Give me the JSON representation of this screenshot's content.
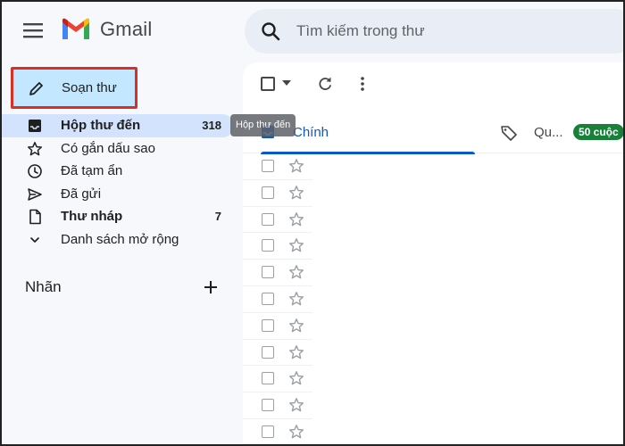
{
  "header": {
    "app_name": "Gmail",
    "menu_icon": "hamburger-menu-icon",
    "logo_icon": "gmail-m-logo",
    "brand_colors": [
      "#4285f4",
      "#ea4335",
      "#fbbc04",
      "#34a853",
      "#c5221f"
    ]
  },
  "search": {
    "placeholder": "Tìm kiếm trong thư",
    "icon": "search-icon"
  },
  "compose": {
    "label": "Soạn thư",
    "icon": "pencil-icon",
    "highlight_color": "#d93025"
  },
  "sidebar": {
    "items": [
      {
        "label": "Hộp thư đến",
        "count": "318",
        "icon": "inbox-icon",
        "active": true,
        "bold": true
      },
      {
        "label": "Có gắn dấu sao",
        "count": "",
        "icon": "star-icon",
        "active": false,
        "bold": false
      },
      {
        "label": "Đã tạm ẩn",
        "count": "",
        "icon": "clock-icon",
        "active": false,
        "bold": false
      },
      {
        "label": "Đã gửi",
        "count": "",
        "icon": "send-icon",
        "active": false,
        "bold": false
      },
      {
        "label": "Thư nháp",
        "count": "7",
        "icon": "draft-icon",
        "active": false,
        "bold": true
      },
      {
        "label": "Danh sách mở rộng",
        "count": "",
        "icon": "chevron-down-icon",
        "active": false,
        "bold": false
      }
    ],
    "labels_header": "Nhãn",
    "labels_add_icon": "plus-icon"
  },
  "tooltip": {
    "text": "Hộp thư đến"
  },
  "toolbar": {
    "select_icon": "checkbox-icon",
    "select_menu_icon": "caret-down-icon",
    "refresh_icon": "refresh-icon",
    "more_icon": "more-vert-icon"
  },
  "tabs": [
    {
      "label": "Chính",
      "icon": "inbox-icon",
      "active": true
    },
    {
      "label": "Qu...",
      "icon": "tag-icon",
      "active": false,
      "badge": "50 cuộc"
    }
  ],
  "colors": {
    "accent": "#0b57d0",
    "badge": "#188038",
    "active_item_bg": "#d3e3fd",
    "compose_bg": "#c2e7ff"
  },
  "email_rows_count": 11
}
